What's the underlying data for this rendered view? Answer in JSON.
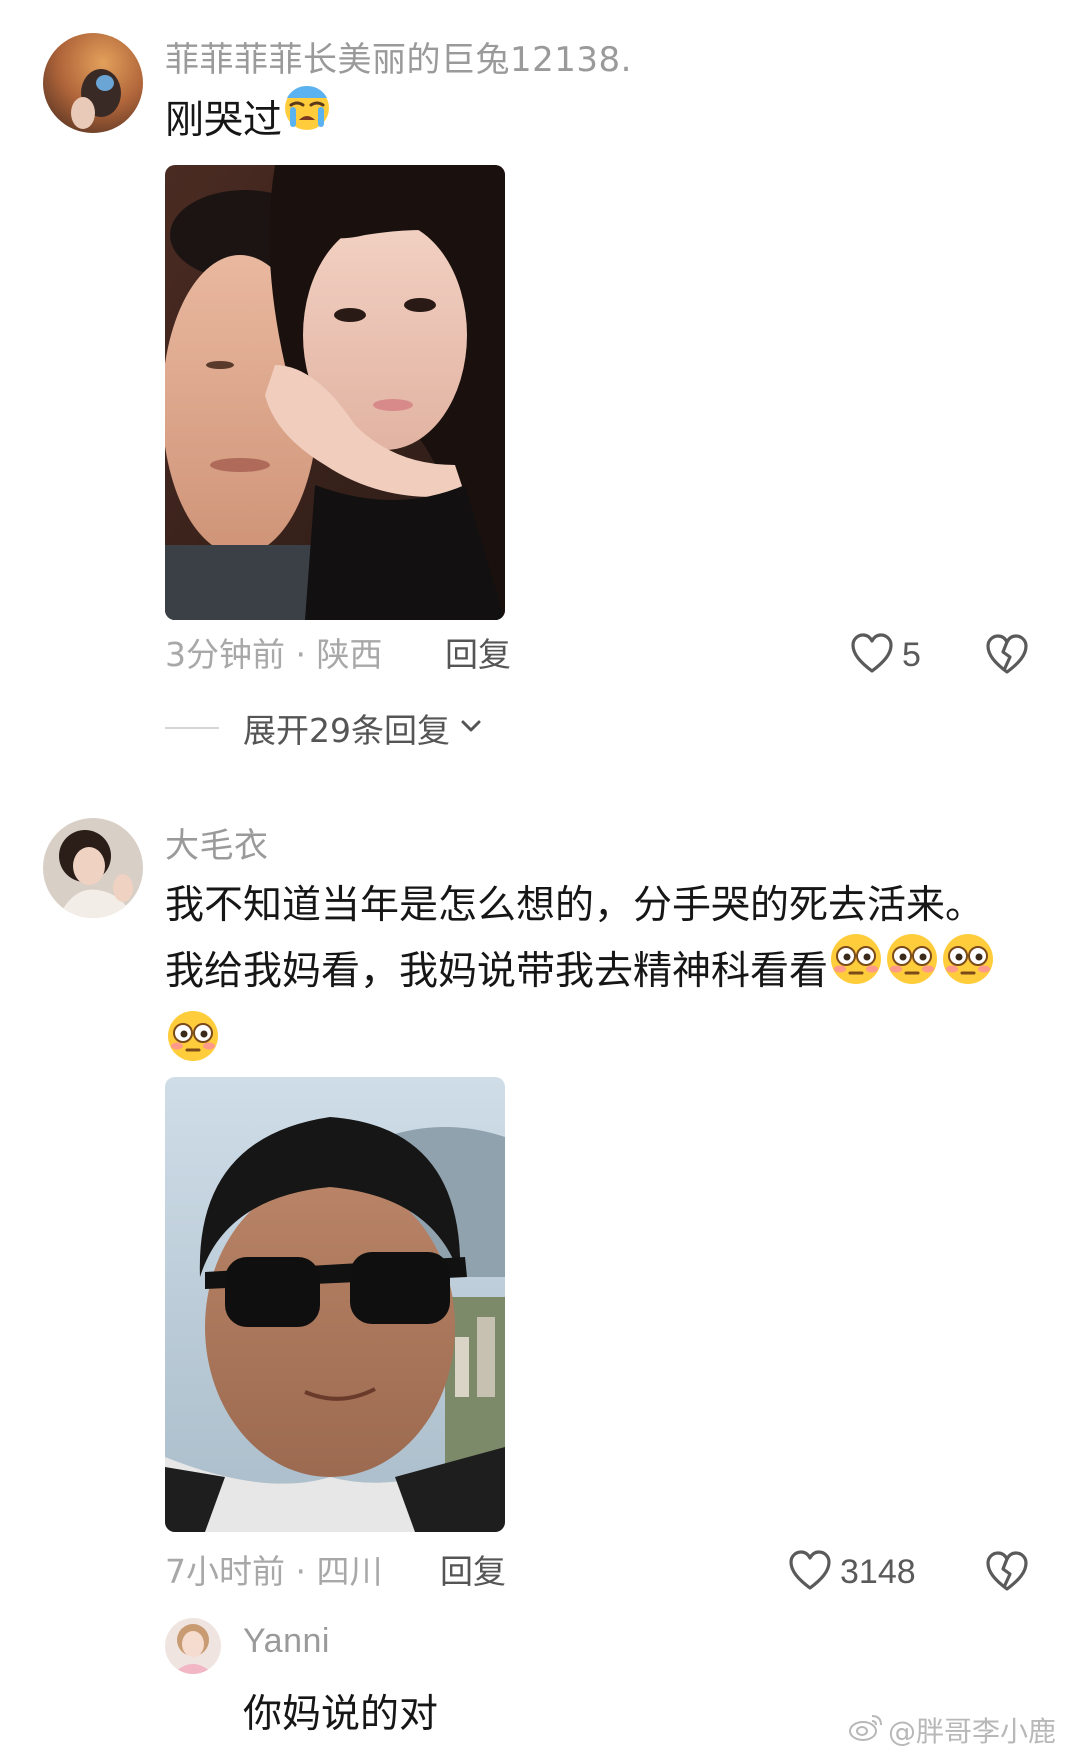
{
  "comments": [
    {
      "username": "菲菲菲菲长美丽的巨兔12138.",
      "text_line1": "刚哭过",
      "text_emoji": "loudly-crying-emoji",
      "time_location": "3分钟前 · 陕西",
      "reply_label": "回复",
      "like_count": "5",
      "expand_label": "展开29条回复"
    },
    {
      "username": "大毛衣",
      "text_line1": "我不知道当年是怎么想的，分手哭的死去活来。",
      "text_line2": "我给我妈看，我妈说带我去精神科看看",
      "text_emoji": "flushed-face-emoji",
      "time_location": "7小时前 · 四川",
      "reply_label": "回复",
      "like_count": "3148"
    }
  ],
  "reply": {
    "username": "Yanni",
    "text": "你妈说的对"
  },
  "watermark": "@胖哥李小鹿",
  "icons": {
    "like": "heart-outline-icon",
    "dislike": "broken-heart-icon",
    "expand": "chevron-down-icon",
    "weibo": "weibo-logo-icon"
  },
  "colors": {
    "username_gray": "#9a9a9a",
    "meta_gray": "#a8a8a8",
    "text_black": "#161616"
  }
}
